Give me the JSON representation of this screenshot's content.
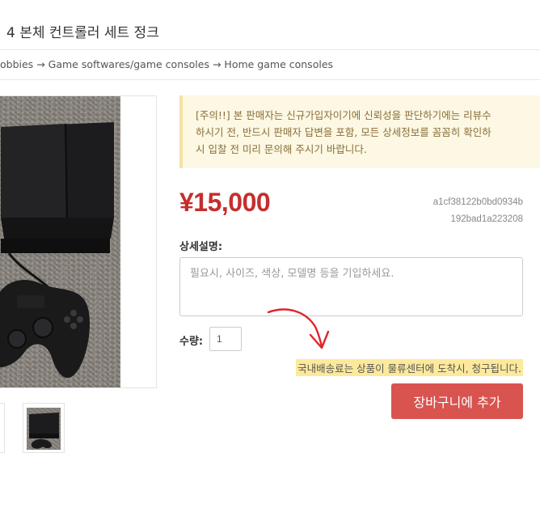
{
  "product": {
    "title": "4 본체 컨트롤러 세트 정크"
  },
  "breadcrumb": {
    "items": [
      "obbies",
      "Game softwares/game consoles",
      "Home game consoles"
    ],
    "separator": "→"
  },
  "notice": {
    "lines": [
      "[주의!!] 본 판매자는 신규가입자이기에 신뢰성을 판단하기에는 리뷰수",
      "하시기 전, 반드시 판매자 답변을 포함, 모든 상세정보를 꼼꼼히 확인하",
      "시 입찰 전 미리 문의해 주시기 바랍니다."
    ]
  },
  "price": "¥15,000",
  "item_code": {
    "line1": "a1cf38122b0bd0934b",
    "line2": "192bad1a223208"
  },
  "description": {
    "label": "상세설명:",
    "placeholder": "필요시, 사이즈, 색상, 모델명 등을 기입하세요.",
    "value": ""
  },
  "quantity": {
    "label": "수량:",
    "value": "1"
  },
  "shipping_note": "국내배송료는 상품이 물류센터에 도착시, 청구됩니다.",
  "cart_button": "장바구니에 추가",
  "colors": {
    "price": "#c52e2e",
    "button": "#d9534f",
    "notice_bg": "#fcf8e3",
    "highlight": "#fde99c",
    "annotation_arrow": "#e0262b"
  }
}
